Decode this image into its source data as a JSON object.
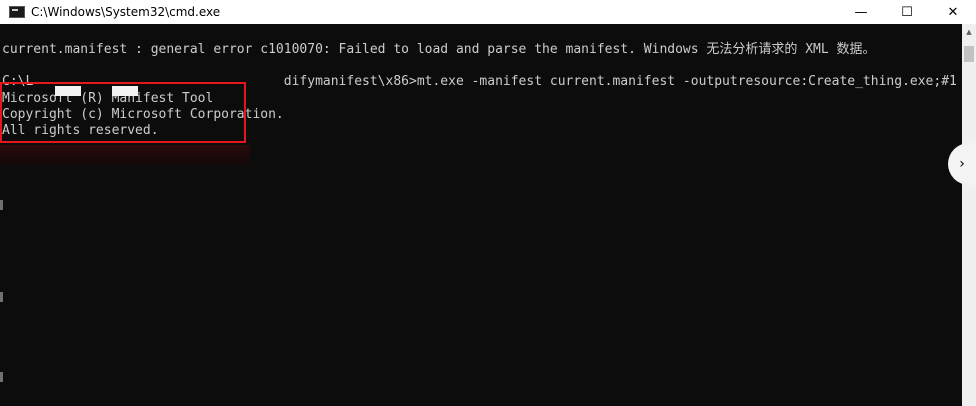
{
  "window": {
    "title": "C:\\Windows\\System32\\cmd.exe",
    "icon": "cmd-icon",
    "controls": {
      "minimize": "—",
      "maximize": "☐",
      "close": "✕"
    }
  },
  "console": {
    "lines": [
      "current.manifest : general error c1010070: Failed to load and parse the manifest. Windows 无法分析请求的 XML 数据。",
      "C:\\L                                difymanifest\\x86>mt.exe -manifest current.manifest -outputresource:Create_thing.exe;#1",
      "Microsoft (R) Manifest Tool",
      "Copyright (c) Microsoft Corporation.",
      "All rights reserved."
    ]
  },
  "colors": {
    "console_bg": "#0c0c0c",
    "console_text": "#cccccc",
    "highlight": "#e5161d"
  },
  "icons": {
    "scroll_up": "chevron-up-icon",
    "side_handle": "chevron-right-icon"
  }
}
